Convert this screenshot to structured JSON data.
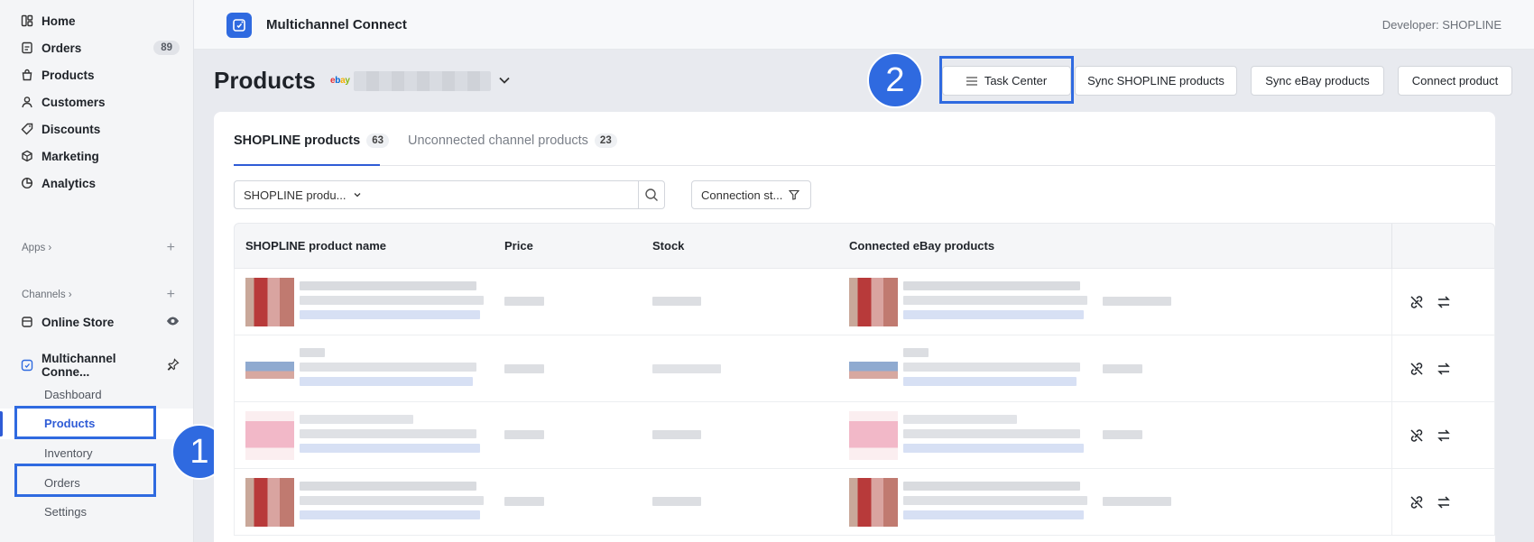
{
  "sidebar": {
    "items": [
      {
        "label": "Home",
        "icon": "home-icon"
      },
      {
        "label": "Orders",
        "icon": "orders-icon",
        "badge": "89"
      },
      {
        "label": "Products",
        "icon": "products-icon"
      },
      {
        "label": "Customers",
        "icon": "customers-icon"
      },
      {
        "label": "Discounts",
        "icon": "discounts-icon"
      },
      {
        "label": "Marketing",
        "icon": "marketing-icon"
      },
      {
        "label": "Analytics",
        "icon": "analytics-icon"
      }
    ],
    "apps_label": "Apps",
    "channels_label": "Channels",
    "online_store": "Online Store",
    "app_name": "Multichannel Conne...",
    "sub_items": [
      "Dashboard",
      "Products",
      "Inventory",
      "Orders",
      "Settings"
    ],
    "active_sub": "Products"
  },
  "topbar": {
    "app_title": "Multichannel Connect",
    "developer": "Developer: SHOPLINE"
  },
  "page": {
    "title": "Products",
    "buttons": {
      "task_center": "Task Center",
      "sync_shopline": "Sync SHOPLINE products",
      "sync_ebay": "Sync eBay products",
      "connect": "Connect product"
    }
  },
  "tabs": [
    {
      "label": "SHOPLINE products",
      "count": "63",
      "active": true
    },
    {
      "label": "Unconnected channel products",
      "count": "23",
      "active": false
    }
  ],
  "filters": {
    "select_value": "SHOPLINE produ...",
    "search_placeholder": "",
    "connection_status": "Connection st..."
  },
  "table": {
    "headers": [
      "SHOPLINE product name",
      "Price",
      "Stock",
      "Connected eBay products"
    ]
  },
  "annotations": {
    "step1": "1",
    "step2": "2"
  },
  "colors": {
    "accent": "#2f5cd6",
    "highlight": "#2f6ae0"
  }
}
